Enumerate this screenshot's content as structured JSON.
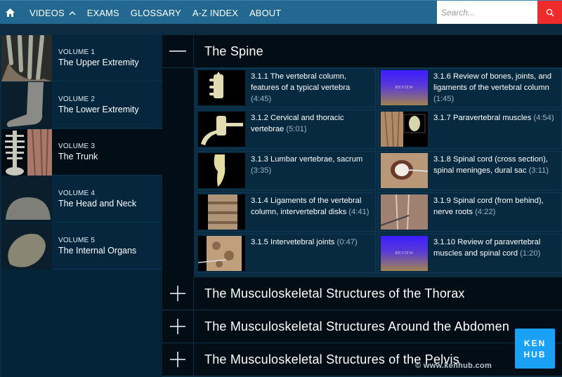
{
  "nav": {
    "home_icon": "home-icon",
    "items": [
      {
        "label": "VIDEOS",
        "has_chevron": true,
        "chevron_icon": "chevron-up-icon"
      },
      {
        "label": "EXAMS"
      },
      {
        "label": "GLOSSARY"
      },
      {
        "label": "A-Z INDEX"
      },
      {
        "label": "ABOUT"
      }
    ],
    "search": {
      "placeholder": "Search...",
      "value": "",
      "icon": "search-icon"
    }
  },
  "sidebar": {
    "volumes": [
      {
        "number": "VOLUME 1",
        "title": "The Upper Extremity",
        "active": false
      },
      {
        "number": "VOLUME 2",
        "title": "The Lower Extremity",
        "active": false
      },
      {
        "number": "VOLUME 3",
        "title": "The Trunk",
        "active": true
      },
      {
        "number": "VOLUME 4",
        "title": "The Head and Neck",
        "active": false
      },
      {
        "number": "VOLUME 5",
        "title": "The Internal Organs",
        "active": false
      }
    ]
  },
  "main": {
    "sections": [
      {
        "title": "The Spine",
        "expanded": true,
        "toggle_icon": "minus-icon"
      },
      {
        "title": "The Musculoskeletal Structures of the Thorax",
        "expanded": false,
        "toggle_icon": "plus-icon"
      },
      {
        "title": "The Musculoskeletal Structures Around the Abdomen",
        "expanded": false,
        "toggle_icon": "plus-icon"
      },
      {
        "title": "The Musculoskeletal Structures of the Pelvis",
        "expanded": false,
        "toggle_icon": "plus-icon"
      }
    ],
    "videos": [
      {
        "title": "3.1.1 The vertebral column, features of a typical vertebra",
        "duration": "(4:45)",
        "thumb": "vertebra"
      },
      {
        "title": "3.1.2 Cervical and thoracic vertebrae",
        "duration": "(5:01)",
        "thumb": "cervical"
      },
      {
        "title": "3.1.3 Lumbar vertebrae, sacrum",
        "duration": "(3:35)",
        "thumb": "lumbar"
      },
      {
        "title": "3.1.4 Ligaments of the vertebral column, intervertebral disks",
        "duration": "(4:41)",
        "thumb": "ligaments"
      },
      {
        "title": "3.1.5 Intervetebral joints",
        "duration": "(0:47)",
        "thumb": "joints"
      },
      {
        "title": "3.1.6 Review of bones, joints, and ligaments of the vertebral column",
        "duration": "(1:45)",
        "thumb": "review"
      },
      {
        "title": "3.1.7 Paravertebral muscles",
        "duration": "(4:54)",
        "thumb": "muscles"
      },
      {
        "title": "3.1.8 Spinal cord (cross section), spinal meninges, dural sac",
        "duration": "(3:11)",
        "thumb": "crosssection"
      },
      {
        "title": "3.1.9 Spinal cord (from behind), nerve roots",
        "duration": "(4:22)",
        "thumb": "behind"
      },
      {
        "title": "3.1.10 Review of paravertebral muscles and spinal cord",
        "duration": "(1:20)",
        "thumb": "review"
      }
    ],
    "review_label": "REVIEW"
  },
  "branding": {
    "badge_line1": "KEN",
    "badge_line2": "HUB",
    "watermark": "© www.kenhub.com"
  }
}
